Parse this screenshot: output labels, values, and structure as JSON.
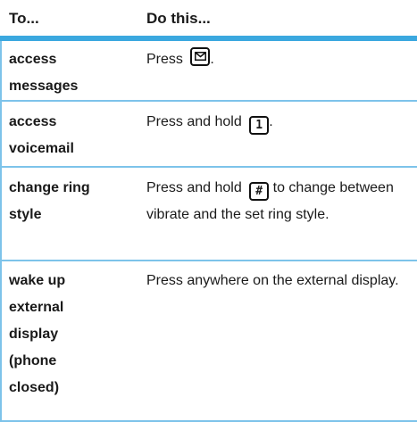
{
  "header": {
    "col1": "To...",
    "col2": "Do this..."
  },
  "rows": [
    {
      "action_lines": [
        "access",
        "messages"
      ],
      "desc_prefix": "Press ",
      "desc_suffix": ".",
      "key": "envelope"
    },
    {
      "action_lines": [
        "access",
        "voicemail"
      ],
      "desc_prefix": "Press and hold ",
      "desc_suffix": ".",
      "key": "1"
    },
    {
      "action_lines": [
        "change ring",
        "style"
      ],
      "desc_prefix": "Press and hold ",
      "desc_suffix": " to change between vibrate and the set ring style.",
      "key": "#"
    },
    {
      "action_lines": [
        "wake up",
        "external",
        "display",
        "(phone",
        "closed)"
      ],
      "desc_prefix": "Press anywhere on the external display.",
      "desc_suffix": "",
      "key": ""
    }
  ],
  "colors": {
    "header_rule": "#3ba8df",
    "row_rule": "#7dc3ea"
  }
}
